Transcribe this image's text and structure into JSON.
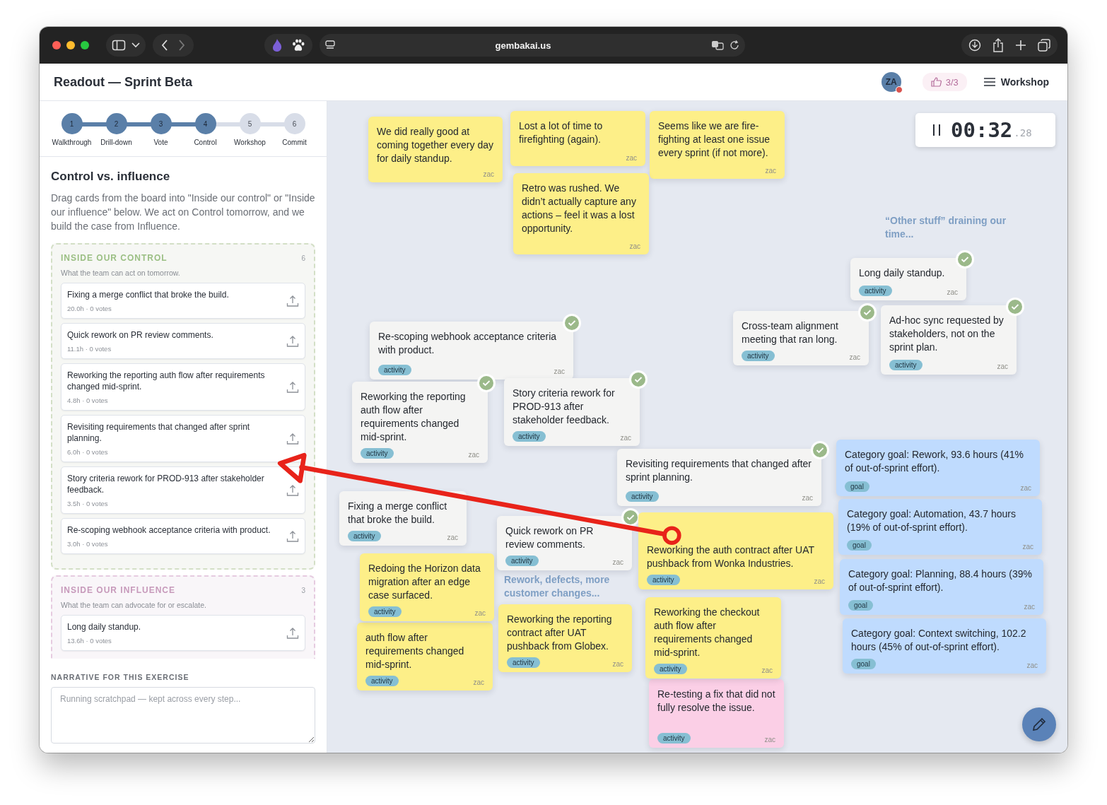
{
  "browser": {
    "url": "gembakai.us"
  },
  "header": {
    "title": "Readout — Sprint Beta",
    "avatar": "ZA",
    "votes": "3/3",
    "menu": "Workshop"
  },
  "steps": [
    {
      "number": "1",
      "label": "Walkthrough",
      "done": true
    },
    {
      "number": "2",
      "label": "Drill-down",
      "done": true
    },
    {
      "number": "3",
      "label": "Vote",
      "done": true
    },
    {
      "number": "4",
      "label": "Control",
      "done": true
    },
    {
      "number": "5",
      "label": "Workshop",
      "done": false
    },
    {
      "number": "6",
      "label": "Commit",
      "done": false
    }
  ],
  "section": {
    "title": "Control vs. influence",
    "description": "Drag cards from the board into \"Inside our control\" or \"Inside our influence\" below. We act on Control tomorrow, and we build the case from Influence."
  },
  "zones": [
    {
      "kind": "control",
      "title": "INSIDE OUR CONTROL",
      "count": "6",
      "subtitle": "What the team can act on tomorrow.",
      "items": [
        {
          "text": "Fixing a merge conflict that broke the build.",
          "meta": "20.0h · 0 votes"
        },
        {
          "text": "Quick rework on PR review comments.",
          "meta": "11.1h · 0 votes"
        },
        {
          "text": "Reworking the reporting auth flow after requirements changed mid-sprint.",
          "meta": "4.8h · 0 votes"
        },
        {
          "text": "Revisiting requirements that changed after sprint planning.",
          "meta": "6.0h · 0 votes"
        },
        {
          "text": "Story criteria rework for PROD-913 after stakeholder feedback.",
          "meta": "3.5h · 0 votes"
        },
        {
          "text": "Re-scoping webhook acceptance criteria with product.",
          "meta": "3.0h · 0 votes"
        }
      ]
    },
    {
      "kind": "influence",
      "title": "INSIDE OUR INFLUENCE",
      "count": "3",
      "subtitle": "What the team can advocate for or escalate.",
      "items": [
        {
          "text": "Long daily standup.",
          "meta": "13.6h · 0 votes"
        }
      ]
    }
  ],
  "narrative": {
    "label": "NARRATIVE FOR THIS EXERCISE",
    "placeholder": "Running scratchpad — kept across every step..."
  },
  "timer": {
    "time": "00:32",
    "fraction": ".28"
  },
  "board_labels": [
    {
      "text": "“Other stuff” draining our time..."
    },
    {
      "text": "Rework, defects, more customer changes..."
    }
  ],
  "notes": [
    {
      "text": "We did really good at coming together every day for daily standup.",
      "author": "zac",
      "color": "#fdef88",
      "checked": false
    },
    {
      "text": "Lost a lot of time to firefighting (again).",
      "author": "zac",
      "color": "#fdef88",
      "checked": false
    },
    {
      "text": "Seems like we are fire-fighting at least one issue every sprint (if not more).",
      "author": "zac",
      "color": "#fdef88",
      "checked": false
    },
    {
      "text": "Retro was rushed. We didn’t actually capture any actions – feel it was a lost opportunity.",
      "author": "zac",
      "color": "#fdef88",
      "checked": false
    },
    {
      "text": "Re-scoping webhook acceptance criteria with product.",
      "tag": "activity",
      "author": "zac",
      "color": "#f4f4f3",
      "checked": true
    },
    {
      "text": "Reworking the reporting auth flow after requirements changed mid-sprint.",
      "tag": "activity",
      "author": "zac",
      "color": "#f4f4f3",
      "checked": true
    },
    {
      "text": "Story criteria rework for PROD-913 after stakeholder feedback.",
      "tag": "activity",
      "author": "zac",
      "color": "#f4f4f3",
      "checked": true
    },
    {
      "text": "Fixing a merge conflict that broke the build.",
      "tag": "activity",
      "author": "zac",
      "color": "#f4f4f3",
      "checked": false
    },
    {
      "text": "Quick rework on PR review comments.",
      "tag": "activity",
      "author": "zac",
      "color": "#f4f4f3",
      "checked": true
    },
    {
      "text": "Revisiting requirements that changed after sprint planning.",
      "tag": "activity",
      "author": "zac",
      "color": "#f4f4f3",
      "checked": true
    },
    {
      "text": "Long daily standup.",
      "tag": "activity",
      "author": "zac",
      "color": "#f4f4f3",
      "checked": true
    },
    {
      "text": "Cross-team alignment meeting that ran long.",
      "tag": "activity",
      "author": "zac",
      "color": "#f4f4f3",
      "checked": true
    },
    {
      "text": "Ad-hoc sync requested by stakeholders, not on the sprint plan.",
      "tag": "activity",
      "author": "zac",
      "color": "#f4f4f3",
      "checked": true
    },
    {
      "text": "Reworking the auth contract after UAT pushback from Wonka Industries.",
      "tag": "activity",
      "author": "zac",
      "color": "#fdef88",
      "checked": false
    },
    {
      "text": "Reworking the checkout auth flow after requirements changed mid-sprint.",
      "tag": "activity",
      "author": "zac",
      "color": "#fdef88",
      "checked": false
    },
    {
      "text": "Redoing the Horizon data migration after an edge case surfaced.",
      "tag": "activity",
      "author": "zac",
      "color": "#fdef88",
      "checked": false
    },
    {
      "text": "auth flow after requirements changed mid-sprint.",
      "tag": "activity",
      "author": "zac",
      "color": "#fdef88",
      "checked": false
    },
    {
      "text": "Reworking the reporting contract after UAT pushback from Globex.",
      "tag": "activity",
      "author": "zac",
      "color": "#fdef88",
      "checked": false
    },
    {
      "text": "Re-testing a fix that did not fully resolve the issue.",
      "tag": "activity",
      "author": "zac",
      "color": "#fbcfe6",
      "checked": false
    },
    {
      "text": "Category goal: Rework, 93.6 hours (41% of out-of-sprint effort).",
      "tag": "goal",
      "author": "zac",
      "color": "#bfdbfe",
      "checked": false
    },
    {
      "text": "Category goal: Automation, 43.7 hours (19% of out-of-sprint effort).",
      "tag": "goal",
      "author": "zac",
      "color": "#bfdbfe",
      "checked": false
    },
    {
      "text": "Category goal: Planning, 88.4 hours (39% of out-of-sprint effort).",
      "tag": "goal",
      "author": "zac",
      "color": "#bfdbfe",
      "checked": false
    },
    {
      "text": "Category goal: Context switching, 102.2 hours (45% of out-of-sprint effort).",
      "tag": "goal",
      "author": "zac",
      "color": "#bfdbfe",
      "checked": false
    }
  ]
}
